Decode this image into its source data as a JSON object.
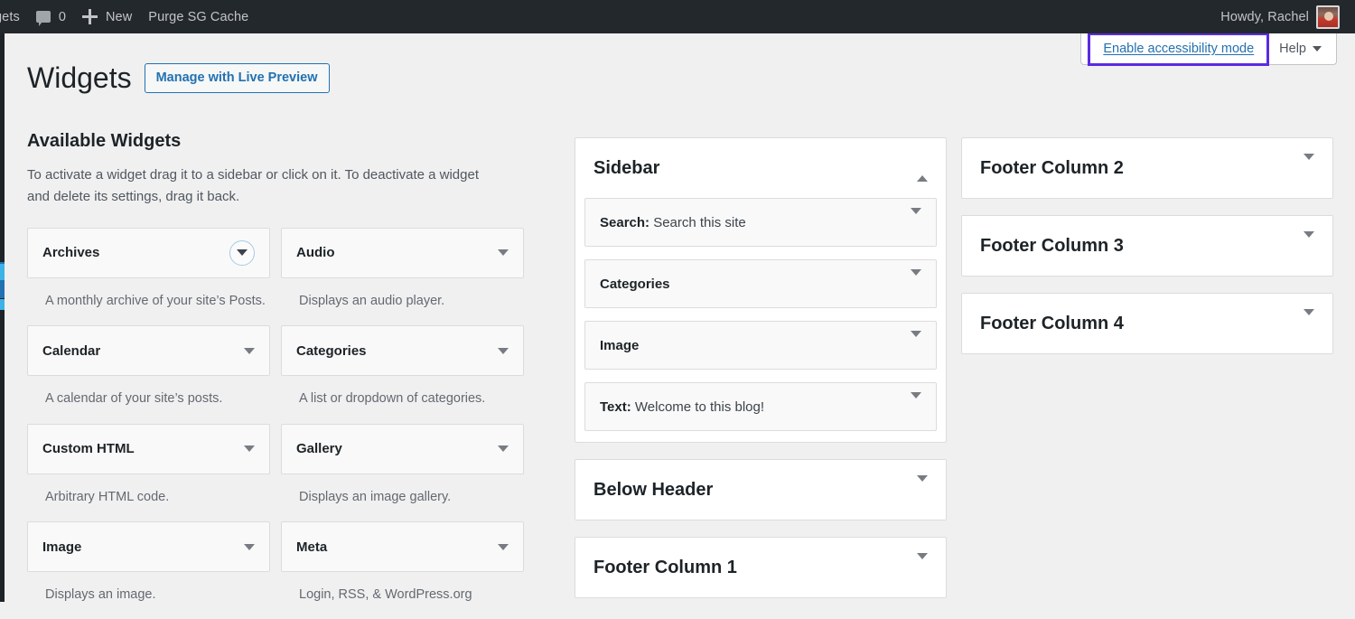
{
  "adminbar": {
    "site_label": "gets",
    "comments_count": "0",
    "new_label": "New",
    "purge_label": "Purge SG Cache",
    "howdy": "Howdy, Rachel"
  },
  "screen_meta": {
    "accessibility_link": "Enable accessibility mode",
    "help_label": "Help"
  },
  "header": {
    "title": "Widgets",
    "live_preview_button": "Manage with Live Preview"
  },
  "available": {
    "heading": "Available Widgets",
    "description": "To activate a widget drag it to a sidebar or click on it. To deactivate a widget and delete its settings, drag it back.",
    "widgets": [
      {
        "name": "Archives",
        "desc": "A monthly archive of your site’s Posts.",
        "toggle": "chevron-down-icon",
        "focused": true
      },
      {
        "name": "Audio",
        "desc": "Displays an audio player.",
        "toggle": "chevron-down-icon",
        "focused": false
      },
      {
        "name": "Calendar",
        "desc": "A calendar of your site’s posts.",
        "toggle": "chevron-down-icon",
        "focused": false
      },
      {
        "name": "Categories",
        "desc": "A list or dropdown of categories.",
        "toggle": "chevron-down-icon",
        "focused": false
      },
      {
        "name": "Custom HTML",
        "desc": "Arbitrary HTML code.",
        "toggle": "chevron-down-icon",
        "focused": false
      },
      {
        "name": "Gallery",
        "desc": "Displays an image gallery.",
        "toggle": "chevron-down-icon",
        "focused": false
      },
      {
        "name": "Image",
        "desc": "Displays an image.",
        "toggle": "chevron-down-icon",
        "focused": false
      },
      {
        "name": "Meta",
        "desc": "Login, RSS, & WordPress.org",
        "toggle": "chevron-down-icon",
        "focused": false
      }
    ]
  },
  "sidebars_middle": [
    {
      "title": "Sidebar",
      "toggle": "chevron-up-icon",
      "expanded": true,
      "widgets": [
        {
          "type": "Search:",
          "instance": "Search this site"
        },
        {
          "type": "Categories",
          "instance": ""
        },
        {
          "type": "Image",
          "instance": ""
        },
        {
          "type": "Text:",
          "instance": "Welcome to this blog!"
        }
      ]
    },
    {
      "title": "Below Header",
      "toggle": "chevron-down-icon",
      "expanded": false,
      "widgets": []
    },
    {
      "title": "Footer Column 1",
      "toggle": "chevron-down-icon",
      "expanded": false,
      "widgets": []
    }
  ],
  "sidebars_right": [
    {
      "title": "Footer Column 2",
      "toggle": "chevron-down-icon",
      "expanded": false,
      "widgets": []
    },
    {
      "title": "Footer Column 3",
      "toggle": "chevron-down-icon",
      "expanded": false,
      "widgets": []
    },
    {
      "title": "Footer Column 4",
      "toggle": "chevron-down-icon",
      "expanded": false,
      "widgets": []
    }
  ],
  "colors": {
    "adminbar_bg": "#23282d",
    "page_bg": "#f0f0f1",
    "link_blue": "#2271b1",
    "focus_purple": "#5b2be0",
    "menu_accent": "#3db2e8"
  }
}
